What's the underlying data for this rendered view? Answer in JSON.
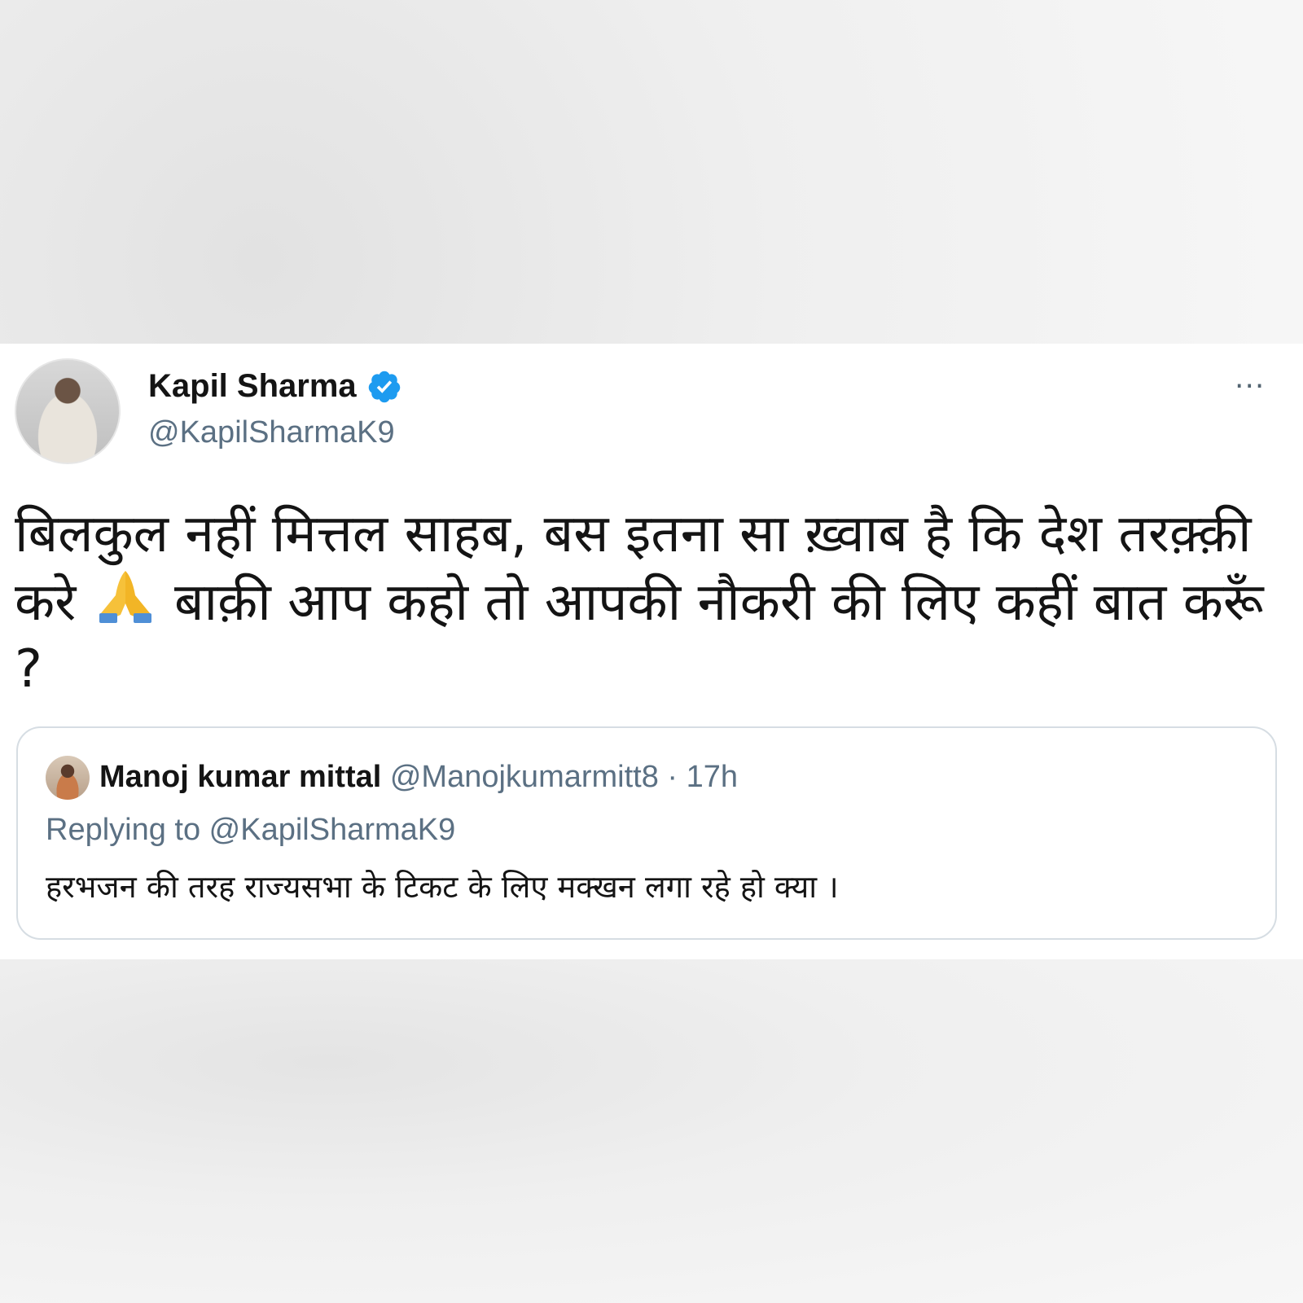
{
  "tweet": {
    "author_name": "Kapil Sharma",
    "author_handle": "@KapilSharmaK9",
    "verified_icon": "verified-badge-icon",
    "more_label": "···",
    "text_part1": "बिलकुल नहीं मित्तल साहब, बस इतना सा ख़्वाब है कि देश तरक़्क़ी करे",
    "emoji": "folded-hands-emoji",
    "text_part2": "बाक़ी आप कहो तो आपकी नौकरी की लिए कहीं बात करूँ ?"
  },
  "quoted_tweet": {
    "author_name": "Manoj kumar mittal",
    "author_handle": "@Manojkumarmitt8",
    "separator": "·",
    "time": "17h",
    "replying_to": "Replying to @KapilSharmaK9",
    "text": "हरभजन की तरह राज्यसभा के टिकट के लिए मक्खन लगा रहे हो क्या ।"
  },
  "colors": {
    "verified_blue": "#1d9bf0",
    "secondary_text": "#5b7083",
    "primary_text": "#141414",
    "border": "#d6dde3"
  }
}
